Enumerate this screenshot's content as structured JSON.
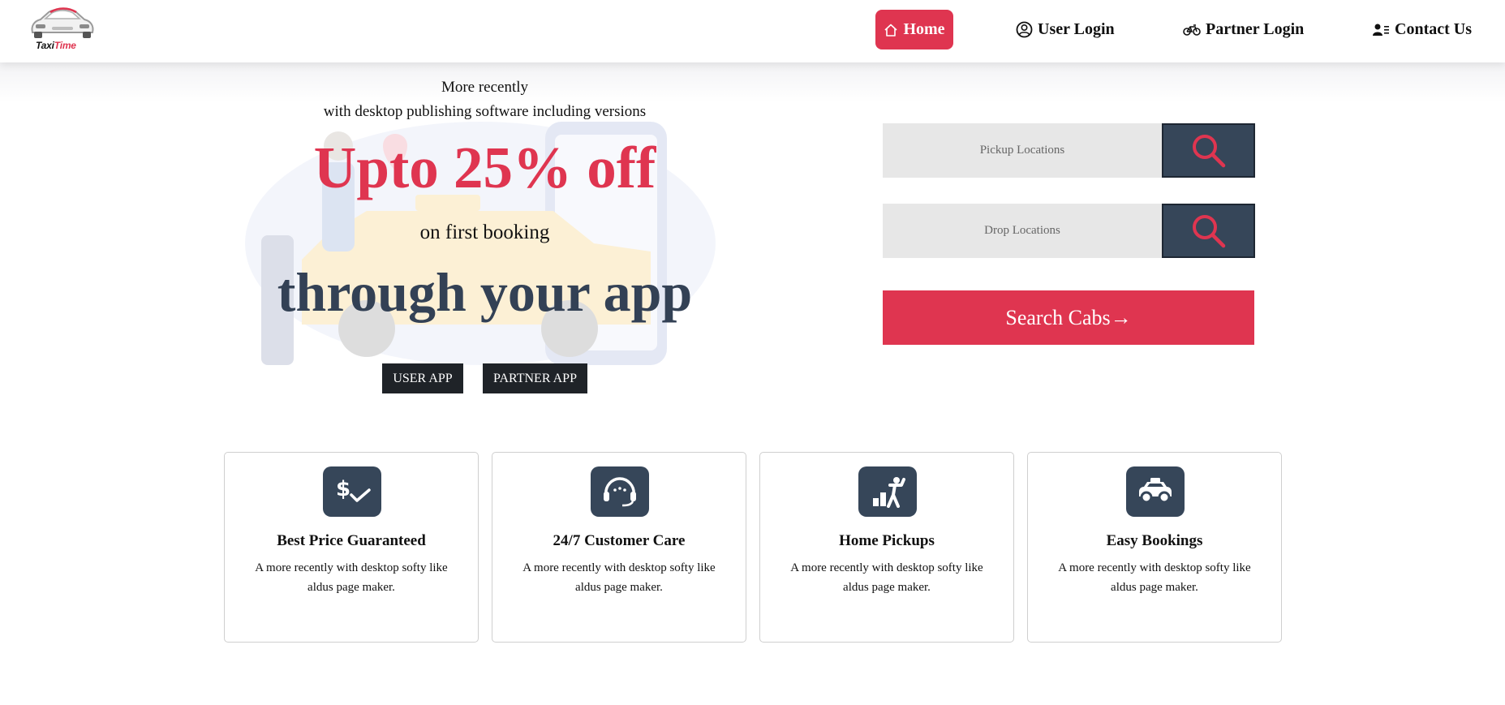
{
  "brand": {
    "name_part1": "Taxi",
    "name_part2": "Time",
    "accent_color": "#df3550",
    "dark_color": "#364659"
  },
  "nav": {
    "home": "Home",
    "user_login": "User Login",
    "partner_login": "Partner Login",
    "contact_us": "Contact Us"
  },
  "hero": {
    "line1": "More recently",
    "line2": "with desktop publishing software including versions",
    "offer": "Upto 25% off",
    "subtitle": "on first booking",
    "headline": "through your app",
    "user_app_button": "USER APP",
    "partner_app_button": "PARTNER APP"
  },
  "search": {
    "pickup_placeholder": "Pickup Locations",
    "drop_placeholder": "Drop Locations",
    "search_button": "Search Cabs→"
  },
  "features": [
    {
      "title": "Best Price Guaranteed",
      "description": "A more recently with desktop softy like aldus page maker.",
      "icon": "price-tag-icon"
    },
    {
      "title": "24/7 Customer Care",
      "description": "A more recently with desktop softy like aldus page maker.",
      "icon": "headset-icon"
    },
    {
      "title": "Home Pickups",
      "description": "A more recently with desktop softy like aldus page maker.",
      "icon": "home-pickup-icon"
    },
    {
      "title": "Easy Bookings",
      "description": "A more recently with desktop softy like aldus page maker.",
      "icon": "car-icon"
    }
  ]
}
